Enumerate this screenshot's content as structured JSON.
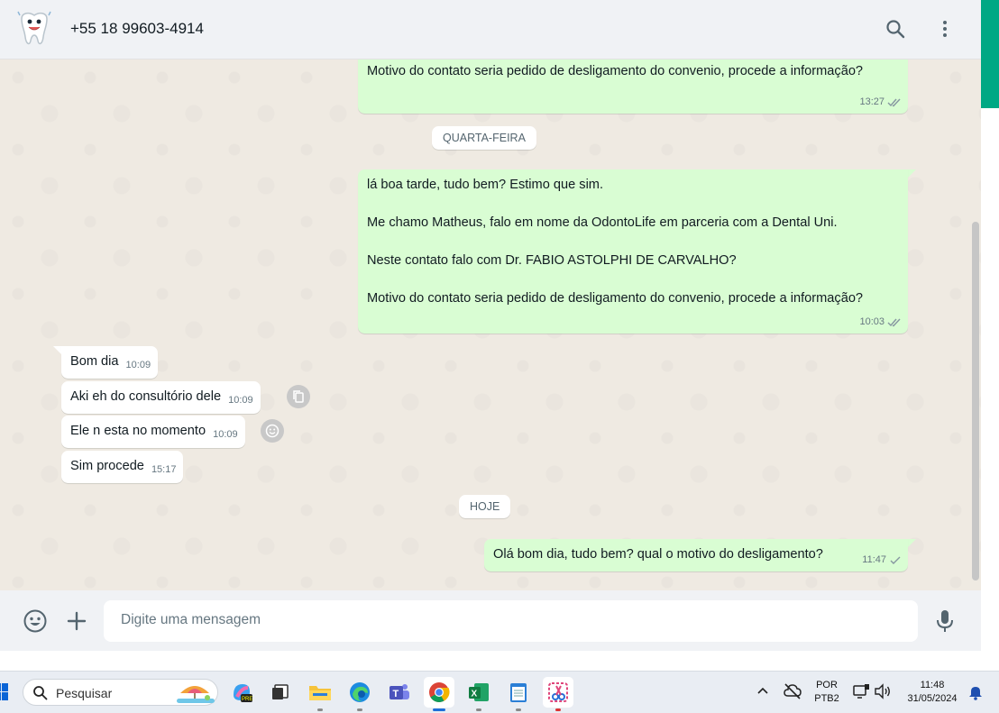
{
  "header": {
    "contact": "+55 18 99603-4914",
    "icons": [
      "tooth-avatar",
      "search-icon",
      "menu-dots-icon"
    ]
  },
  "chat": {
    "messages": [
      {
        "dir": "out",
        "text": "Motivo do contato seria pedido de desligamento do convenio, procede a informação?",
        "time": "13:27",
        "status": "read"
      },
      {
        "dir": "out",
        "lines": [
          "lá boa tarde, tudo bem? Estimo que sim.",
          "Me chamo Matheus, falo em nome da OdontoLife em parceria com a Dental Uni.",
          "Neste contato falo com Dr. FABIO ASTOLPHI DE CARVALHO?",
          "Motivo do contato seria pedido de desligamento do convenio, procede a informação?"
        ],
        "time": "10:03",
        "status": "read"
      },
      {
        "dir": "in",
        "text": "Bom dia",
        "time": "10:09"
      },
      {
        "dir": "in",
        "text": "Aki eh do consultório  dele",
        "time": "10:09"
      },
      {
        "dir": "in",
        "text": "Ele n esta no momento",
        "time": "10:09"
      },
      {
        "dir": "in",
        "text": "Sim procede",
        "time": "15:17"
      },
      {
        "dir": "out",
        "text": "Olá bom dia, tudo bem? qual o motivo do desligamento?",
        "time": "11:47",
        "status": "sent"
      }
    ],
    "day_dividers": [
      "QUARTA-FEIRA",
      "HOJE"
    ]
  },
  "composer": {
    "placeholder": "Digite uma mensagem",
    "icons": [
      "emoji-icon",
      "plus-icon",
      "mic-icon"
    ]
  },
  "taskbar": {
    "search_placeholder": "Pesquisar",
    "apps": [
      "copilot",
      "task-view",
      "file-explorer",
      "edge",
      "teams",
      "chrome",
      "excel",
      "notepad",
      "snipping-tool"
    ],
    "active_app": "chrome",
    "lang_top": "POR",
    "lang_bottom": "PTB2",
    "time": "11:48",
    "date": "31/05/2024"
  }
}
